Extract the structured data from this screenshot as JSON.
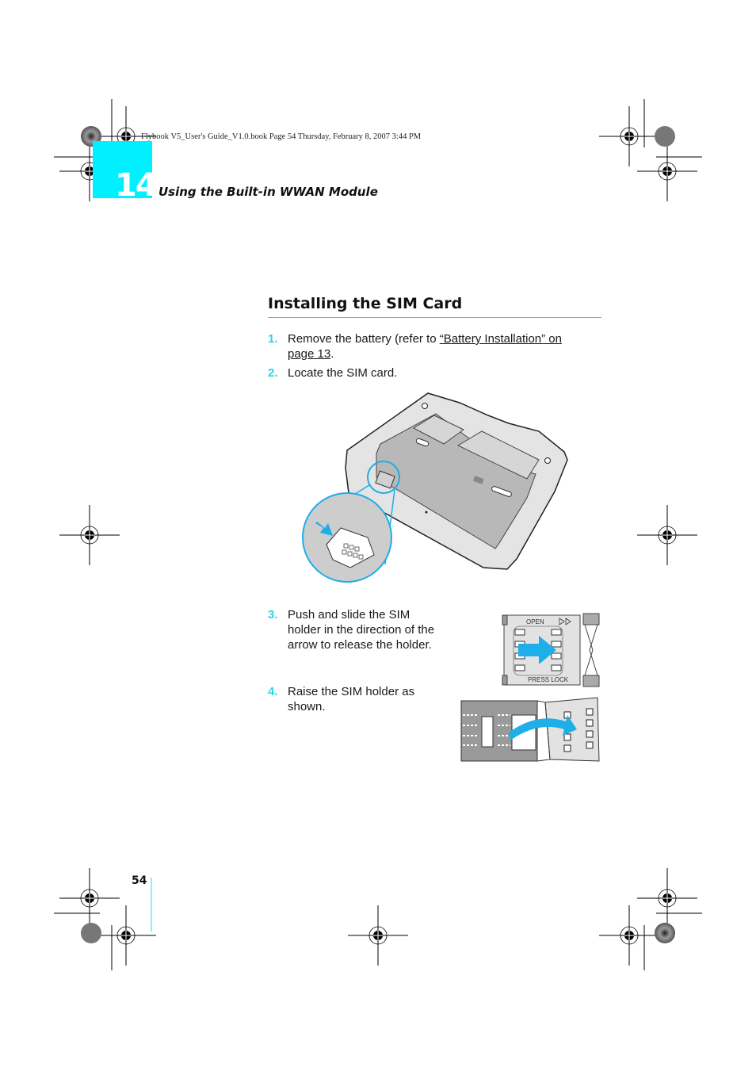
{
  "print_header": "Flybook V5_User's Guide_V1.0.book  Page 54  Thursday, February 8, 2007  3:44 PM",
  "chapter": {
    "number": "14",
    "title": "Using the Built-in WWAN Module"
  },
  "section": {
    "title": "Installing the SIM Card"
  },
  "steps": [
    {
      "number": "1.",
      "text_before": "Remove the battery (refer to ",
      "link_line1": "“Battery Installation” on ",
      "link_line2": "page 13",
      "text_after": "."
    },
    {
      "number": "2.",
      "text": "Locate the SIM card."
    },
    {
      "number": "3.",
      "lines": [
        "Push and slide the SIM",
        "holder in the direction of the",
        "arrow to release the holder."
      ]
    },
    {
      "number": "4.",
      "lines": [
        "Raise the SIM holder as",
        "shown."
      ]
    }
  ],
  "figures": {
    "sim_holder_push": {
      "label_open": "OPEN",
      "label_press_lock": "PRESS LOCK"
    }
  },
  "page_number": "54",
  "colors": {
    "accent_cyan": "#00f0ff",
    "step_number": "#20d8ea",
    "arrow_blue": "#1eaee8"
  }
}
